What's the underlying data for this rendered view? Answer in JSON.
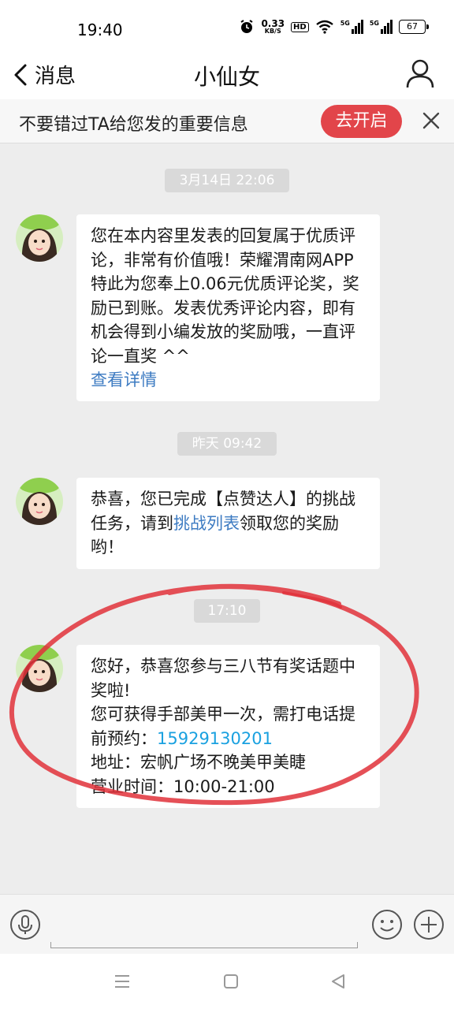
{
  "status_bar": {
    "time": "19:40",
    "speed_value": "0.33",
    "speed_unit": "KB/S",
    "hd": "HD",
    "signal1": "5G",
    "signal2": "5G",
    "battery": "67"
  },
  "header": {
    "back_label": "消息",
    "title": "小仙女"
  },
  "notice": {
    "text": "不要错过TA给您发的重要信息",
    "button_label": "去开启"
  },
  "messages": [
    {
      "timestamp": "3月14日 22:06",
      "text": "您在本内容里发表的回复属于优质评论，非常有价值哦！荣耀渭南网APP特此为您奉上0.06元优质评论奖，奖励已到账。发表优秀评论内容，即有机会得到小编发放的奖励哦，一直评论一直奖 ^^",
      "link": "查看详情"
    },
    {
      "timestamp": "昨天 09:42",
      "text_before": "恭喜，您已完成【点赞达人】的挑战任务，请到",
      "link": "挑战列表",
      "text_after": "领取您的奖励哟！"
    },
    {
      "timestamp": "17:10",
      "line1": "您好，恭喜您参与三八节有奖话题中奖啦!",
      "line2_prefix": "您可获得手部美甲一次，需打电话提前预约：",
      "phone": "15929130201",
      "line3": "地址：宏帆广场不晚美甲美睫",
      "line4": "营业时间：10:00-21:00"
    }
  ],
  "colors": {
    "accent_red": "#e2454a",
    "link_blue": "#3d7bc2",
    "phone_blue": "#1aa1e0",
    "annotation_red": "#e0313a"
  }
}
